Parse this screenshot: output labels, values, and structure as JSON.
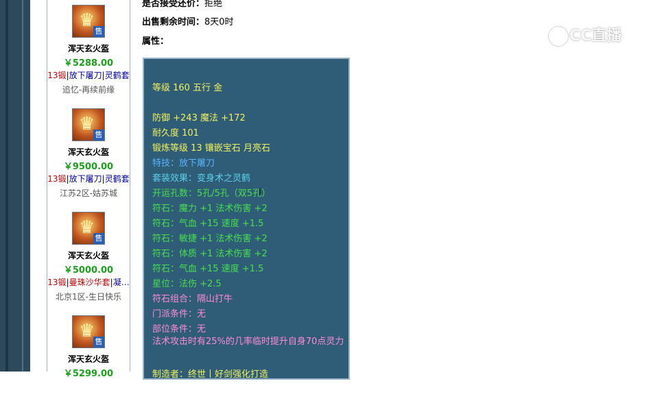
{
  "listing": {
    "items": [
      {
        "name": "浑天玄火盔",
        "price": "￥5288.00",
        "forge": "13锻",
        "skill": "放下屠刀",
        "set": "灵鹤套",
        "server": "追忆-再续前缘",
        "badge": "售"
      },
      {
        "name": "浑天玄火盔",
        "price": "￥9500.00",
        "forge": "13锻",
        "skill": "放下屠刀",
        "set": "灵鹤套",
        "server": "江苏2区-姑苏城",
        "badge": "售"
      },
      {
        "name": "浑天玄火盔",
        "price": "￥5000.00",
        "forge": "13锻",
        "skill": "曼珠沙华套",
        "set": "凝…",
        "server": "北京1区-生日快乐",
        "badge": "售"
      },
      {
        "name": "浑天玄火盔",
        "price": "￥5299.00",
        "forge": "",
        "skill": "",
        "set": "",
        "server": "",
        "badge": "售"
      }
    ]
  },
  "detail": {
    "accept_counter_label": "是否接受还价：",
    "accept_counter_value": "拒绝",
    "remaining_label": "出售剩余时间：",
    "remaining_value": "8天0时",
    "attributes_label": "属性："
  },
  "tooltip": {
    "level_line": "等级 160 五行 金",
    "defense_line": "防御 +243 魔法 +172",
    "durability_line": "耐久度 101",
    "forge_line": "锻炼等级 13 镶嵌宝石 月亮石",
    "special_skill": "特技：放下屠刀",
    "set_effect": "套装效果：变身术之灵鹤",
    "holes": "开运孔数：5孔/5孔（双5孔）",
    "rune1": "符石：魔力 +1 法术伤害 +2",
    "rune2": "符石：气血 +15 速度 +1.5",
    "rune3": "符石：敏捷 +1 法术伤害 +2",
    "rune4": "符石：体质 +1 法术伤害 +2",
    "rune5": "符石：气血 +15 速度 +1.5",
    "star": "星位：法伤 +2.5",
    "rune_combo": "符石组合：隔山打牛",
    "school_req": "门派条件：无",
    "part_req": "部位条件：无",
    "effect": "法术攻击时有25%的几率临时提升自身70点灵力",
    "maker": "制造者：终世丨好剑强化打造"
  },
  "watermark": {
    "text": "CC直播"
  },
  "colors": {
    "rail": "#2c4a5c",
    "tooltip_bg": "#2f5d78",
    "price": "#1aa01a",
    "forge": "#c00000"
  }
}
